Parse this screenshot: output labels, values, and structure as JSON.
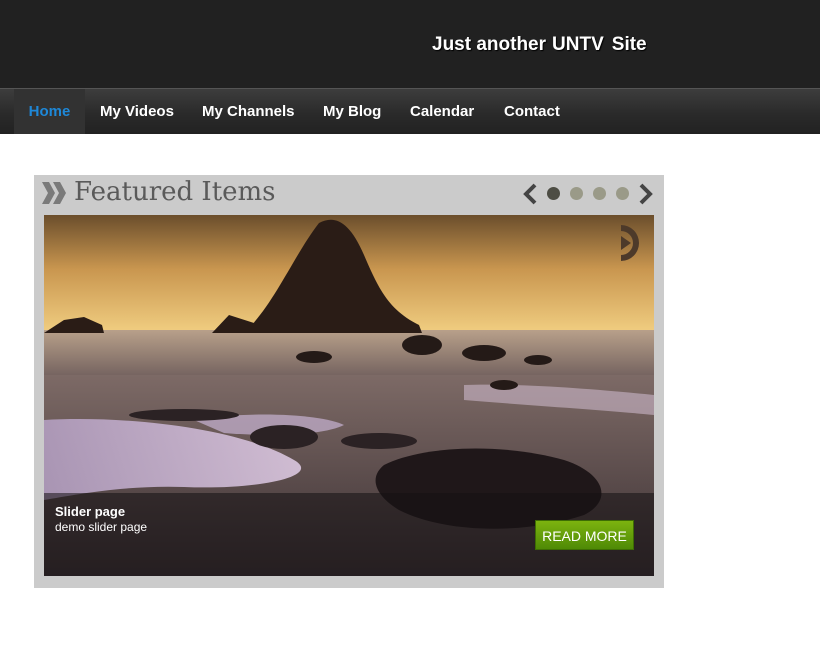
{
  "header": {
    "tagline": "Just another",
    "site_name_1": "UNTV",
    "site_name_2": "Site"
  },
  "nav": {
    "items": [
      {
        "label": "Home",
        "active": true
      },
      {
        "label": "My Videos"
      },
      {
        "label": "My Channels"
      },
      {
        "label": "My Blog"
      },
      {
        "label": "Calendar"
      },
      {
        "label": "Contact"
      }
    ]
  },
  "featured": {
    "title": "Featured Items",
    "slide_count": 4,
    "current_slide": 1,
    "slide": {
      "title": "Slider page",
      "subtitle": "demo slider page",
      "button": "READ MORE"
    }
  },
  "icons": {
    "prev": "chevron-left-icon",
    "next": "chevron-right-icon",
    "title": "double-chevron-icon",
    "play": "play-icon"
  },
  "colors": {
    "header_bg": "#212121",
    "nav_active": "#1e88d8",
    "panel_bg": "#cbcbcb",
    "button": "#6aa10b"
  }
}
